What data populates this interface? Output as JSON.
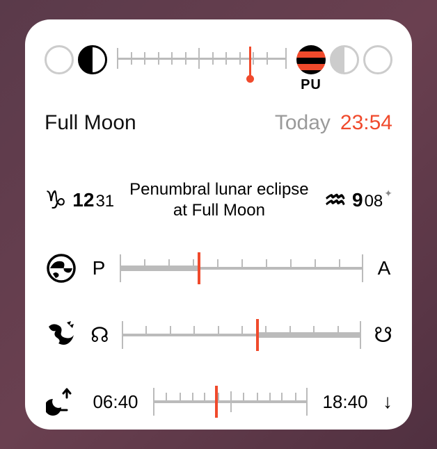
{
  "header": {
    "pu_label": "PU",
    "progress_percent": 78
  },
  "title": {
    "phase": "Full Moon",
    "day_label": "Today",
    "time": "23:54"
  },
  "event_text": "Penumbral lunar eclipse at Full Moon",
  "position_left": {
    "sign": "capricorn",
    "glyph": "♑︎",
    "degrees": "12",
    "minutes": "31"
  },
  "position_right": {
    "sign": "aquarius",
    "glyph": "♒︎",
    "degrees": "9",
    "minutes": "08",
    "has_star": true
  },
  "apsis": {
    "left_label": "P",
    "right_label": "A",
    "percent": 32
  },
  "node": {
    "left_glyph": "☊",
    "right_glyph": "☋",
    "percent": 56
  },
  "rise_set": {
    "rise": "06:40",
    "set": "18:40",
    "percent": 40
  }
}
